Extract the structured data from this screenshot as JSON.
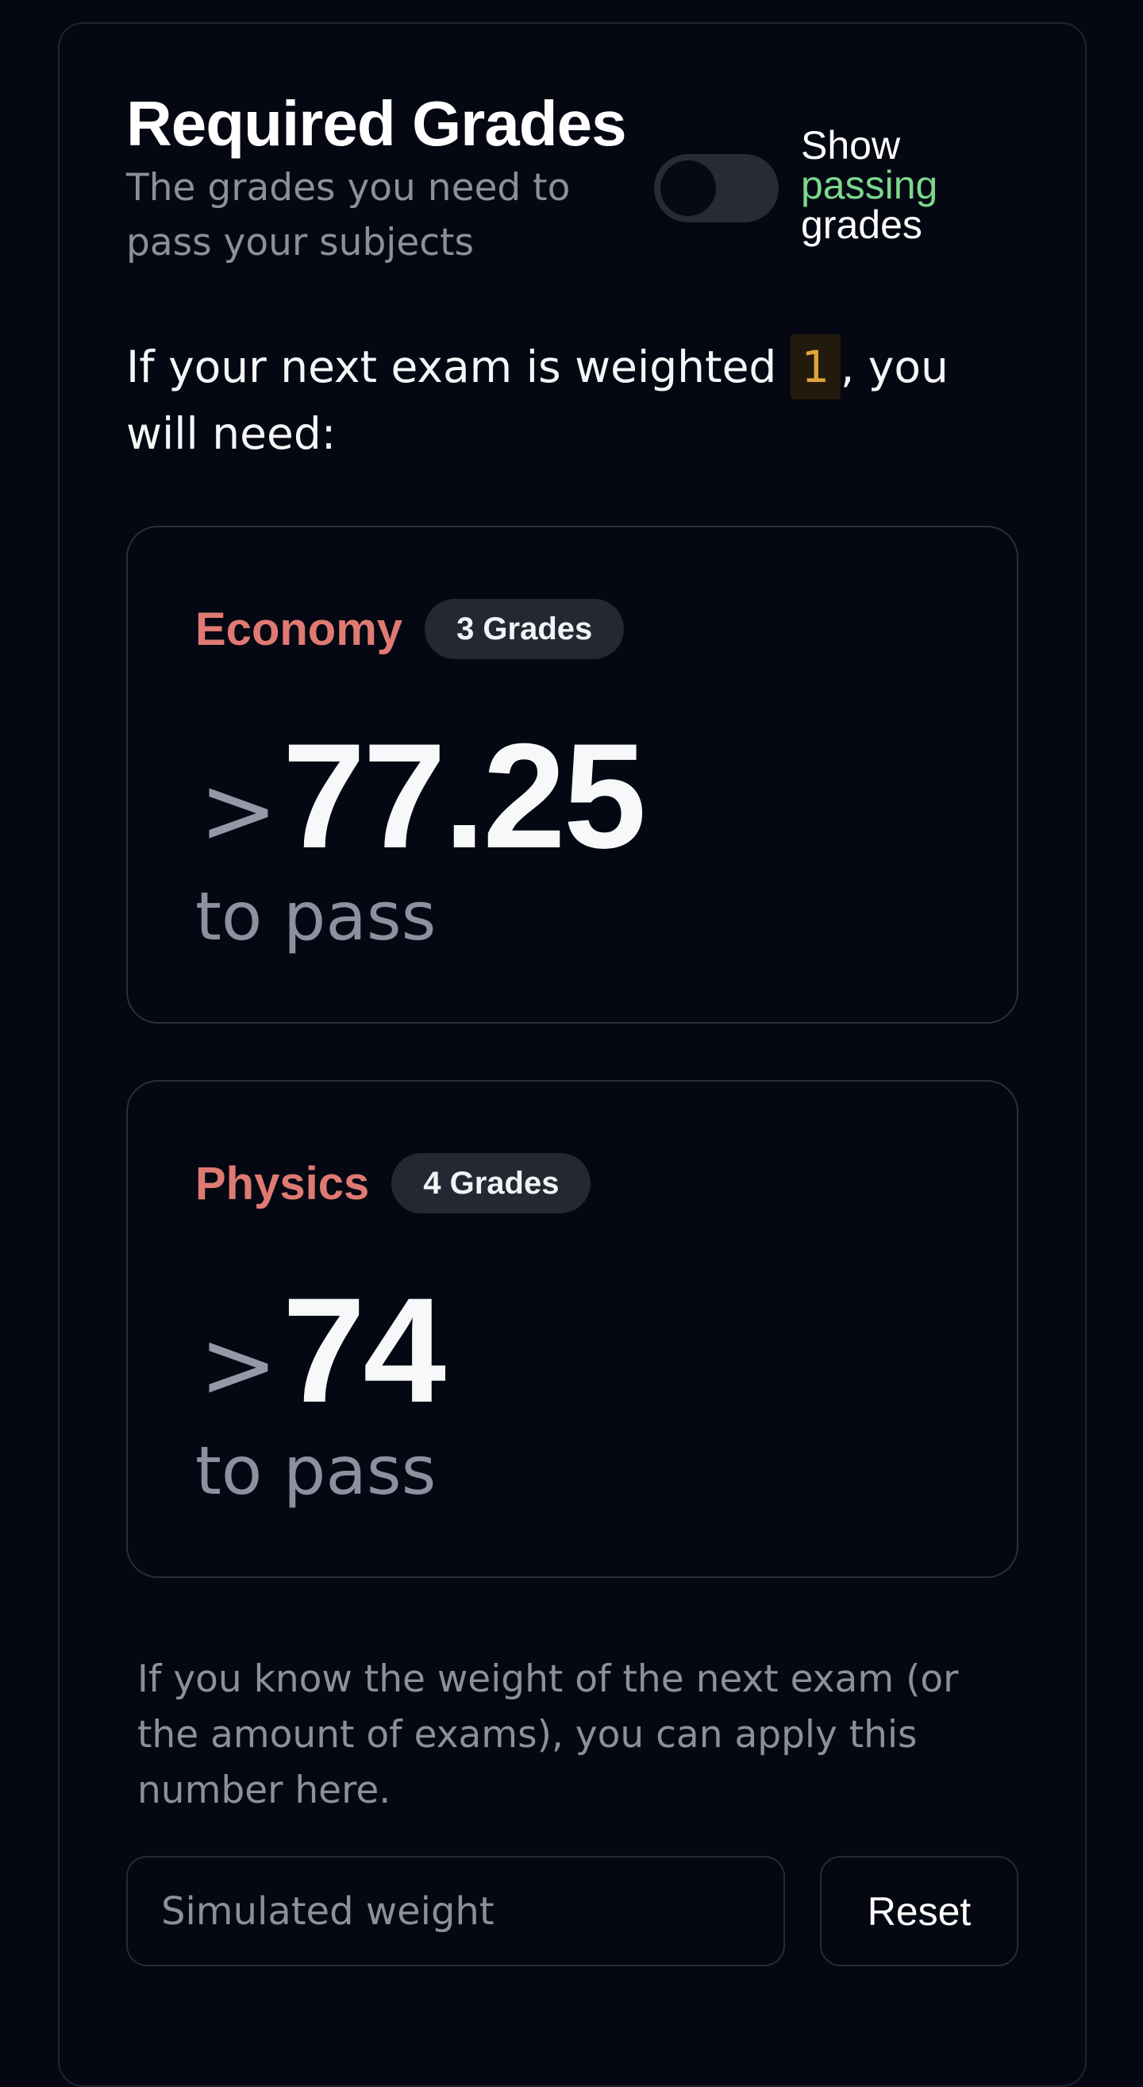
{
  "header": {
    "title": "Required Grades",
    "subtitle": "The grades you need to pass your subjects"
  },
  "toggle": {
    "label_show": "Show",
    "label_passing": "passing",
    "label_grades": "grades",
    "checked": false,
    "accent_color": "#7bd88b"
  },
  "weight_sentence": {
    "prefix": "If your next exam is weighted ",
    "weight": "1",
    "suffix": ", you will need:"
  },
  "subjects": [
    {
      "name": "Economy",
      "grades_badge": "3 Grades",
      "comparator": ">",
      "required": "77.25",
      "caption": "to pass"
    },
    {
      "name": "Physics",
      "grades_badge": "4 Grades",
      "comparator": ">",
      "required": "74",
      "caption": "to pass"
    }
  ],
  "hint": "If you know the weight of the next exam (or the amount of exams), you can apply this number here.",
  "form": {
    "input_placeholder": "Simulated weight",
    "input_value": "",
    "reset_label": "Reset"
  },
  "colors": {
    "background": "#050812",
    "subject_name": "#df7a73",
    "weight_highlight": "#e0a43a",
    "muted_text": "#8b909c"
  }
}
